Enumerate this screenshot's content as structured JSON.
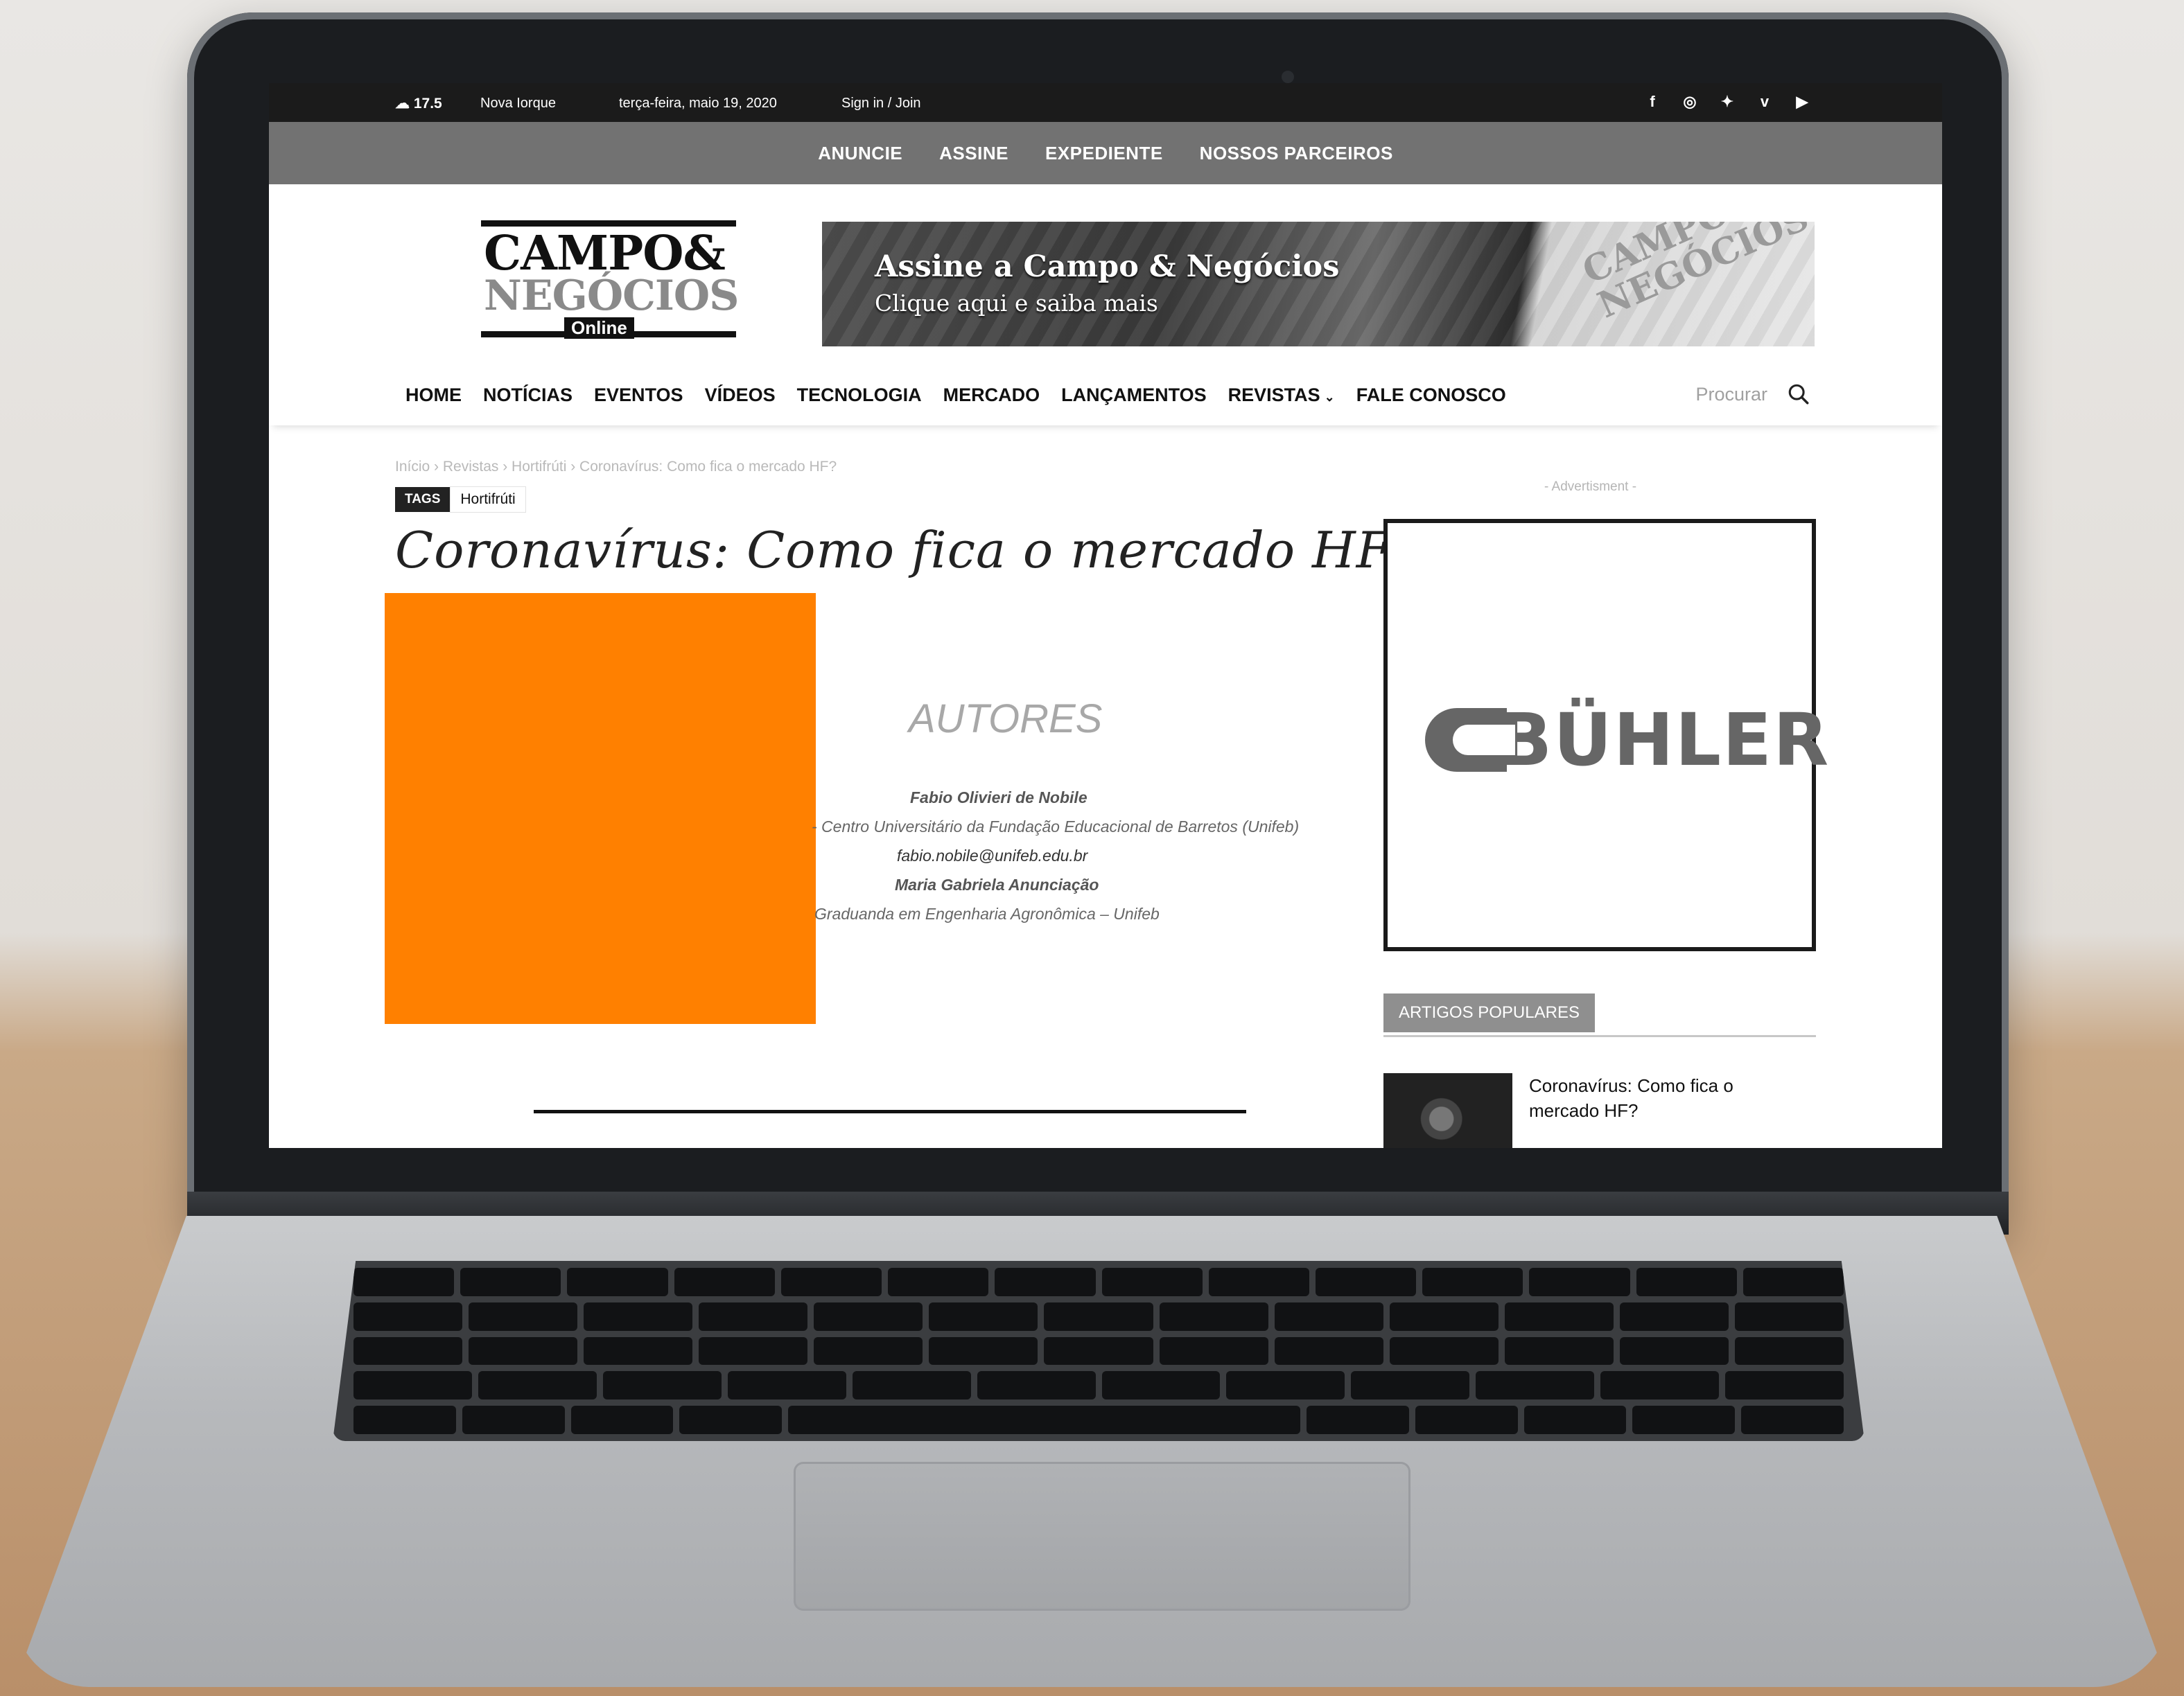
{
  "topbar": {
    "temperature": "17.5",
    "city": "Nova Iorque",
    "date": "terça-feira, maio 19, 2020",
    "signin": "Sign in / Join",
    "social_icons": [
      "facebook-icon",
      "instagram-icon",
      "twitter-icon",
      "vimeo-icon",
      "youtube-icon"
    ]
  },
  "top_menu": [
    "ANUNCIE",
    "ASSINE",
    "EXPEDIENTE",
    "NOSSOS PARCEIROS"
  ],
  "logo": {
    "line1": "CAMPO&",
    "line2": "NEGÓCIOS",
    "line3": "Online"
  },
  "banner": {
    "headline": "Assine a Campo & Negócios",
    "subline": "Clique aqui e saiba mais",
    "cover_text": "CAMPO NEGÓCIOS"
  },
  "nav": {
    "items": [
      "HOME",
      "NOTÍCIAS",
      "EVENTOS",
      "VÍDEOS",
      "TECNOLOGIA",
      "MERCADO",
      "LANÇAMENTOS",
      "REVISTAS",
      "FALE CONOSCO"
    ],
    "search_placeholder": "Procurar"
  },
  "breadcrumb": "Início  ›  Revistas  ›  Hortifrúti  ›  Coronavírus: Como fica o mercado HF?",
  "tags": {
    "label": "TAGS",
    "value": "Hortifrúti"
  },
  "article": {
    "title": "Coronavírus: Como fica o mercado HF?",
    "authors_heading": "AUTORES",
    "author1": "Fabio Olivieri de Nobile",
    "author1_affiliation": "- Centro Universitário da Fundação Educacional de Barretos (Unifeb)",
    "author1_email": "fabio.nobile@unifeb.edu.br",
    "author2": "Maria Gabriela Anunciação",
    "author2_affiliation": "Graduanda em Engenharia Agronômica – Unifeb"
  },
  "sidebar": {
    "ad_label": "- Advertisment -",
    "ad_brand": "BÜHLER",
    "popular_heading": "ARTIGOS POPULARES",
    "popular_item": "Coronavírus: Como fica o mercado HF?"
  },
  "colors": {
    "accent_orange": "#ff8000",
    "gray_bar": "#727272",
    "top_bar": "#1b1b1b"
  }
}
